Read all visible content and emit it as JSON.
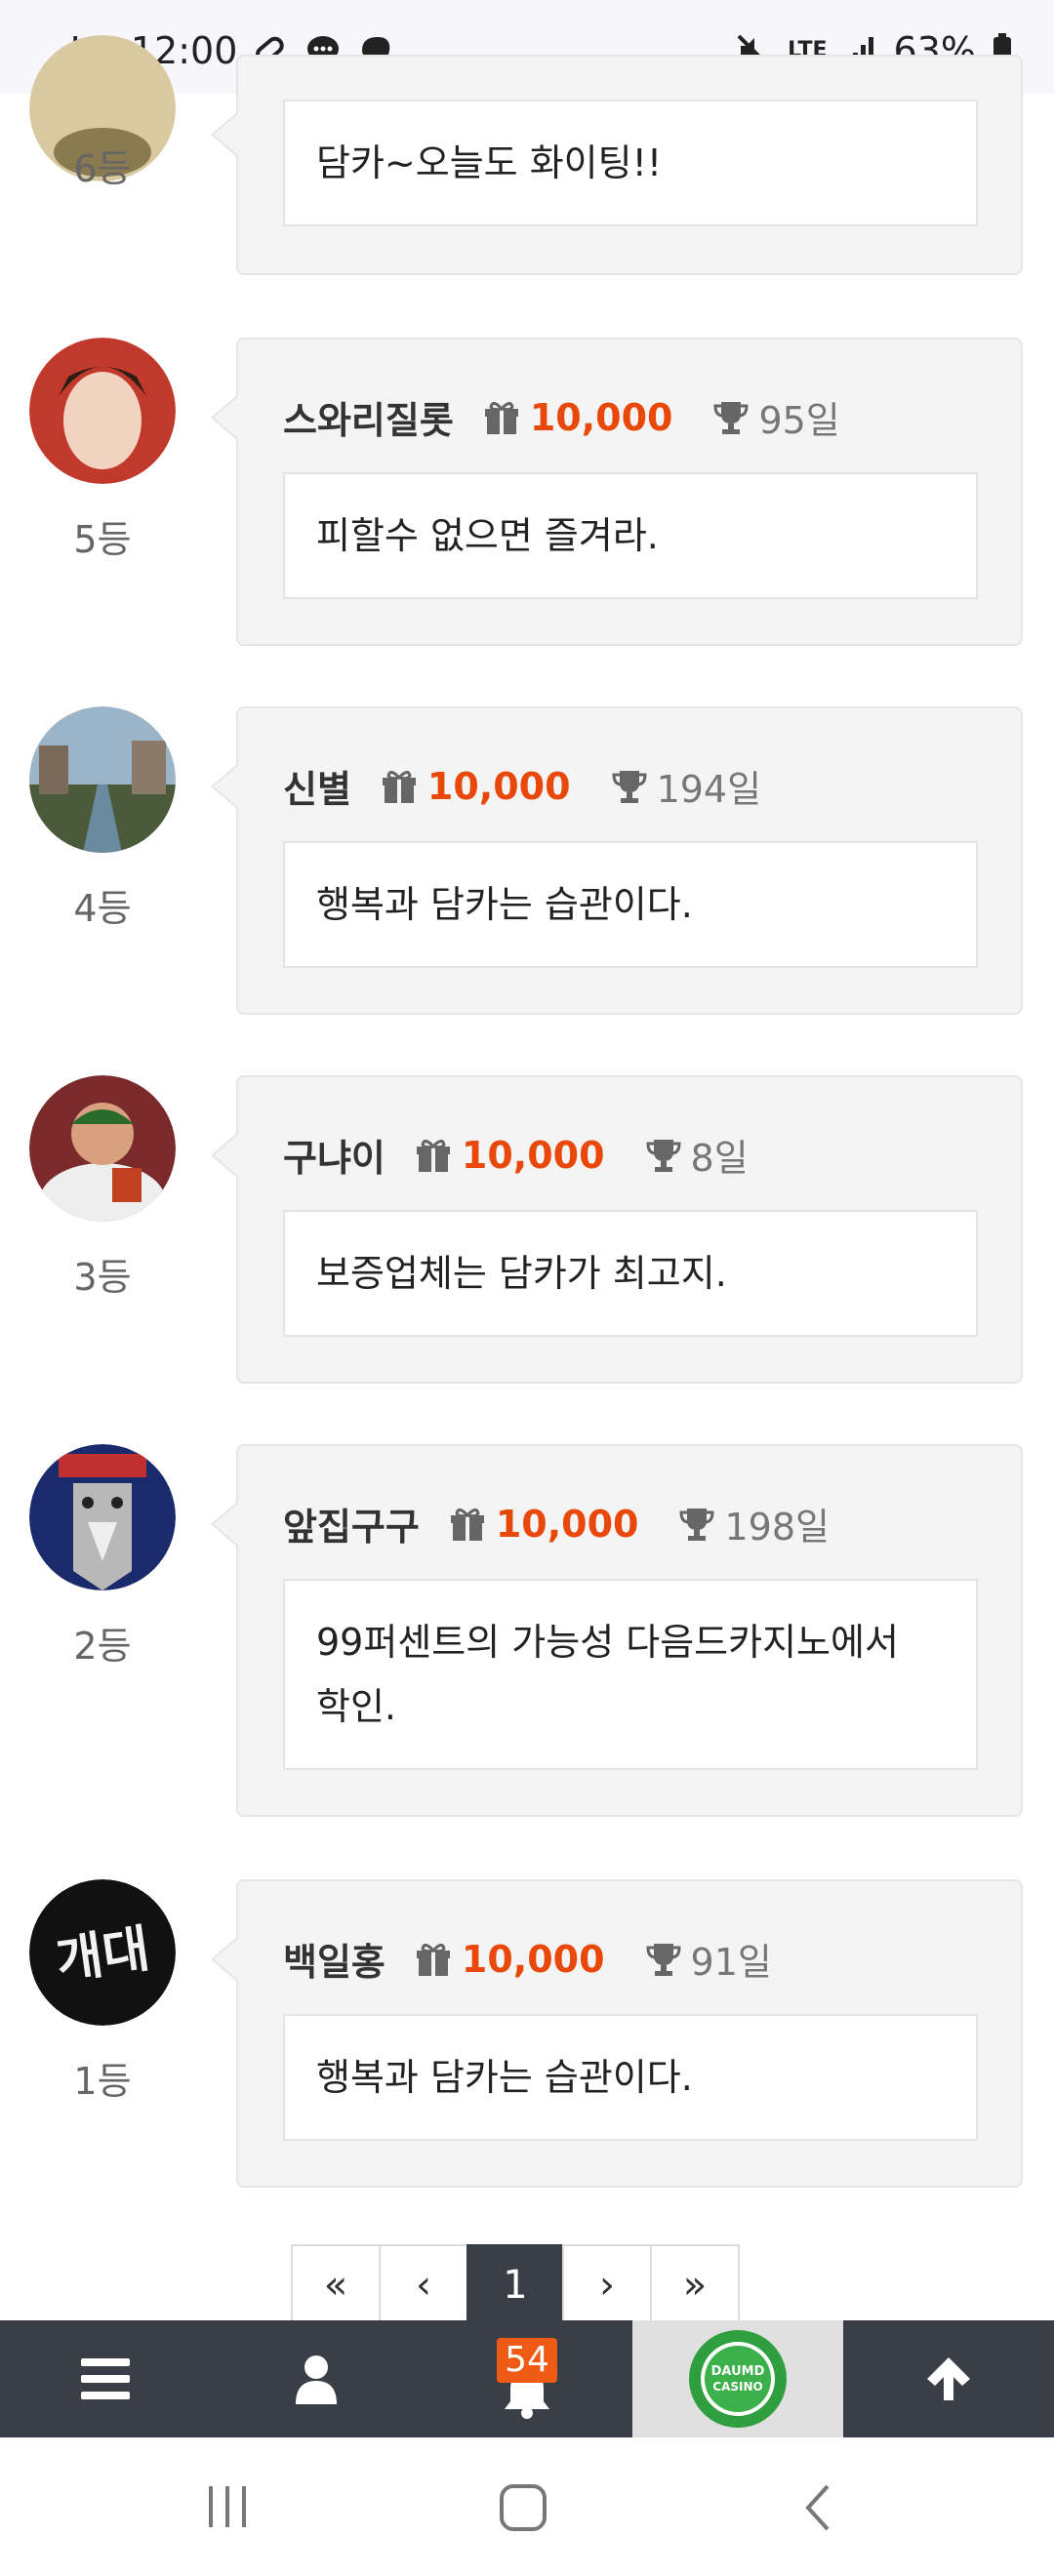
{
  "status_bar": {
    "carrier": "U⁺",
    "time": "12:00",
    "network": "LTE",
    "battery": "63%"
  },
  "icons": {
    "gift": "gift-icon",
    "trophy": "trophy-icon",
    "menu": "menu-icon",
    "user": "user-icon",
    "bell": "bell-icon",
    "up": "arrow-up-icon"
  },
  "colors": {
    "points": "#e8490b",
    "nav_bg": "#3a3f47",
    "badge": "#ef5a14",
    "card_bg": "#f4f4f4"
  },
  "entries": [
    {
      "rank": "6등",
      "nickname": "",
      "points": "",
      "days": "",
      "message": "담카~오늘도 화이팅!!"
    },
    {
      "rank": "5등",
      "nickname": "스와리질롯",
      "points": "10,000",
      "days": "95일",
      "message": "피할수 없으면 즐겨라."
    },
    {
      "rank": "4등",
      "nickname": "신별",
      "points": "10,000",
      "days": "194일",
      "message": "행복과 담카는 습관이다."
    },
    {
      "rank": "3등",
      "nickname": "구냐이",
      "points": "10,000",
      "days": "8일",
      "message": "보증업체는 담카가 최고지."
    },
    {
      "rank": "2등",
      "nickname": "앞집구구",
      "points": "10,000",
      "days": "198일",
      "message_line1": "99퍼센트의 가능성 다음드카지노에서",
      "message_line2": "학인."
    },
    {
      "rank": "1등",
      "nickname": "백일홍",
      "points": "10,000",
      "days": "91일",
      "message": "행복과 담카는 습관이다."
    }
  ],
  "pagination": {
    "first": "«",
    "prev": "‹",
    "current": "1",
    "next": "›",
    "last": "»"
  },
  "bottom_nav": {
    "notification_count": "54",
    "casino_logo_line1": "DAUMD",
    "casino_logo_line2": "CASINO"
  }
}
